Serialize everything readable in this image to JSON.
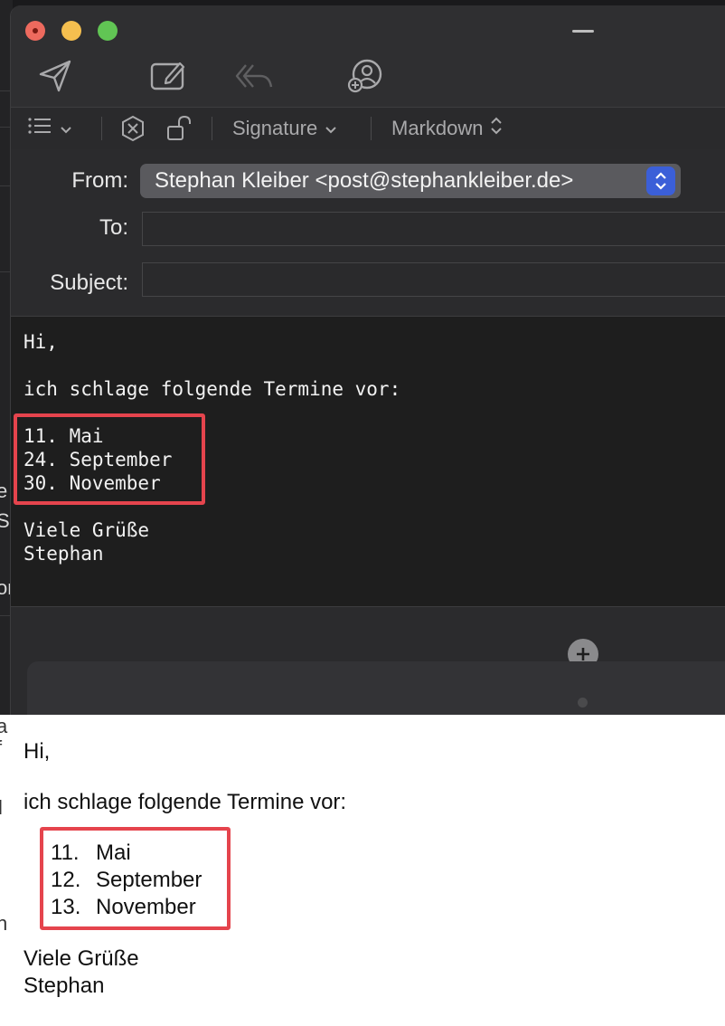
{
  "toolbar": {
    "icons": [
      "send-icon",
      "new-message-icon",
      "reply-all-icon",
      "add-contact-icon"
    ]
  },
  "format_bar": {
    "list_icon": "list-icon",
    "settings_icon": "gear-icon",
    "lock_icon": "unlock-icon",
    "signature_label": "Signature",
    "markdown_label": "Markdown"
  },
  "headers": {
    "from_label": "From:",
    "from_value": "Stephan Kleiber <post@stephankleiber.de>",
    "to_label": "To:",
    "to_value": "",
    "subject_label": "Subject:",
    "subject_value": ""
  },
  "editor": {
    "lines": [
      "Hi,",
      "ich schlage folgende Termine vor:",
      "11. Mai",
      "24. September",
      "30. November",
      "Viele Grüße",
      "Stephan"
    ]
  },
  "preview": {
    "greeting": "Hi,",
    "intro": "ich schlage folgende Termine vor:",
    "list": [
      {
        "number": "11.",
        "text": "Mai"
      },
      {
        "number": "12.",
        "text": "September"
      },
      {
        "number": "13.",
        "text": "November"
      }
    ],
    "closing": "Viele Grüße",
    "name": "Stephan"
  },
  "background_window": {
    "fragments": [
      "e",
      "S",
      "or",
      "a",
      "f",
      "l",
      "h"
    ]
  },
  "colors": {
    "highlight_box": "#e5444d",
    "stepper_accent": "#3b5fd8",
    "close_button": "#ed6a5e",
    "minimize_button": "#f5bf4f",
    "zoom_button": "#61c554"
  }
}
